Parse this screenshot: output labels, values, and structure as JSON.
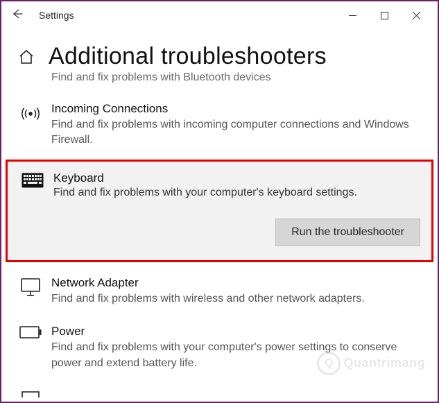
{
  "window": {
    "title": "Settings"
  },
  "page": {
    "heading": "Additional troubleshooters",
    "cutoff_prev_desc": "Find and fix problems with Bluetooth devices"
  },
  "items": {
    "incoming": {
      "name": "Incoming Connections",
      "desc": "Find and fix problems with incoming computer connections and Windows Firewall."
    },
    "keyboard": {
      "name": "Keyboard",
      "desc": "Find and fix problems with your computer's keyboard settings.",
      "button": "Run the troubleshooter"
    },
    "network": {
      "name": "Network Adapter",
      "desc": "Find and fix problems with wireless and other network adapters."
    },
    "power": {
      "name": "Power",
      "desc": "Find and fix problems with your computer's power settings to conserve power and extend battery life."
    }
  },
  "watermark": "Quantrimang"
}
